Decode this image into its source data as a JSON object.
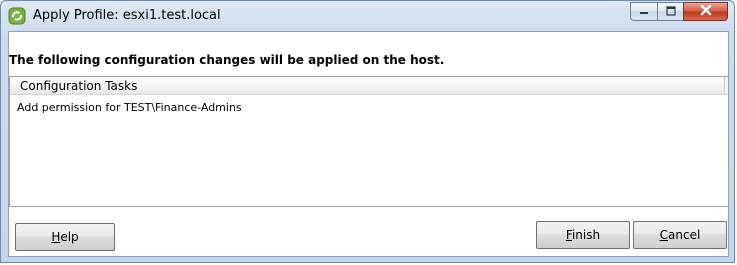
{
  "window": {
    "title": "Apply Profile: esxi1.test.local"
  },
  "dialog": {
    "heading": "The following configuration changes will be applied on the host.",
    "table": {
      "columns": [
        "Configuration Tasks"
      ],
      "rows": [
        "Add permission for TEST\\Finance-Admins"
      ]
    }
  },
  "buttons": {
    "help": {
      "mnemonic": "H",
      "rest": "elp"
    },
    "finish": {
      "mnemonic": "F",
      "rest": "inish"
    },
    "cancel": {
      "mnemonic": "C",
      "rest": "ancel"
    }
  },
  "icons": {
    "app": "vsphere-profile-icon",
    "minimize": "minimize-icon",
    "maximize": "maximize-icon",
    "close": "close-icon"
  }
}
